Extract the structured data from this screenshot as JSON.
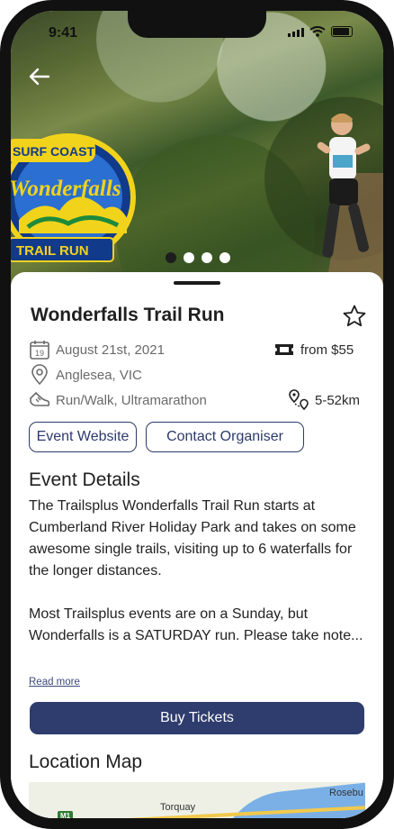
{
  "status_bar": {
    "time": "9:41"
  },
  "hero": {
    "logo_lines": [
      "SURF COAST",
      "Wonderfalls",
      "TRAIL RUN"
    ],
    "carousel": {
      "count": 4,
      "active_index": 0
    }
  },
  "event": {
    "title": "Wonderfalls Trail Run",
    "date": "August 21st, 2021",
    "date_icon_day": "19",
    "location": "Anglesea, VIC",
    "types": "Run/Walk, Ultramarathon",
    "price": "from $55",
    "distance": "5-52km"
  },
  "actions": {
    "website_label": "Event Website",
    "contact_label": "Contact Organiser",
    "buy_label": "Buy Tickets",
    "read_more_label": "Read more"
  },
  "details": {
    "heading": "Event Details",
    "text": "The Trailsplus Wonderfalls Trail Run starts at Cumberland River Holiday Park and takes on some awesome single trails, visiting up to 6 waterfalls for the longer distances.\n\nMost Trailsplus events are on a Sunday, but Wonderfalls is a SATURDAY run. Please take note..."
  },
  "map": {
    "heading": "Location Map",
    "labels": {
      "road": "M1",
      "town1": "Torquay",
      "town2": "Rosebu"
    }
  },
  "colors": {
    "primary": "#2f3d6e",
    "outline": "#2c3a6b"
  }
}
